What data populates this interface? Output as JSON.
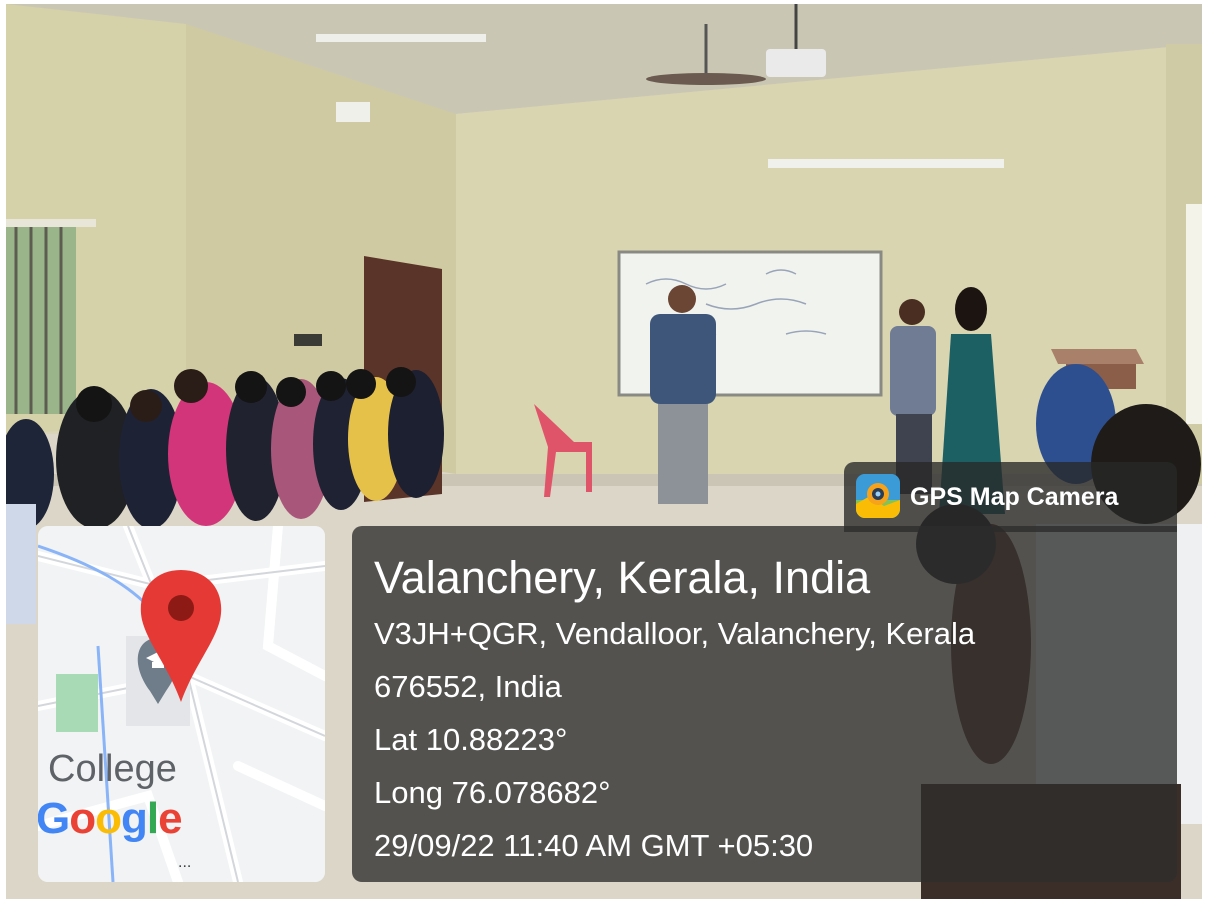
{
  "photo": {
    "description_colors": {
      "wall": "#d8d3ad",
      "floor": "#ded8ca",
      "door": "#5a3428",
      "chair": "#e0546a",
      "whiteboard": "#f1f3ef"
    }
  },
  "gps_app": {
    "label": "GPS Map Camera",
    "icon": "gps-map-camera-icon"
  },
  "location": {
    "headline": "Valanchery, Kerala, India",
    "address_line1": "V3JH+QGR, Vendalloor, Valanchery, Kerala",
    "address_line2": "676552, India",
    "latitude": "Lat 10.88223°",
    "longitude": "Long 76.078682°",
    "timestamp": "29/09/22 11:40 AM GMT +05:30"
  },
  "map": {
    "place_label": "College",
    "brand": [
      "G",
      "o",
      "o",
      "g",
      "l",
      "e"
    ],
    "brand_colors": [
      "#4285f4",
      "#ea4335",
      "#fbbc05",
      "#4285f4",
      "#34a853",
      "#ea4335"
    ],
    "pin_color": "#e53935",
    "more_label": "..."
  }
}
